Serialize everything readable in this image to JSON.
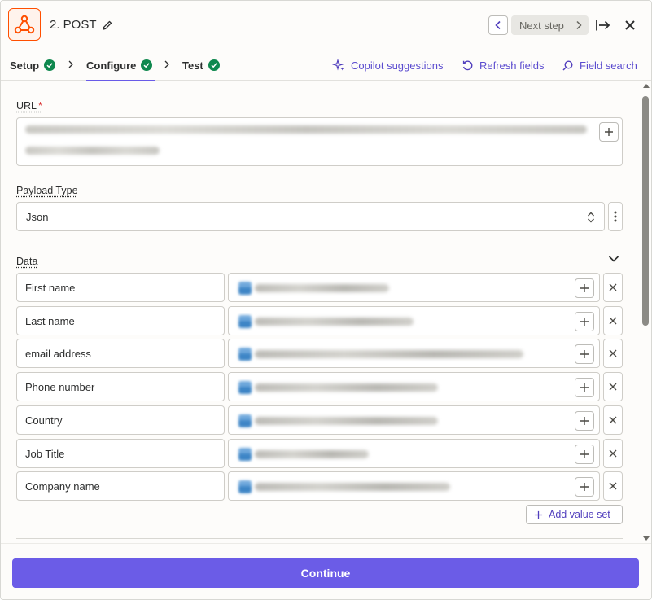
{
  "header": {
    "step_title": "2. POST",
    "next_step_label": "Next step",
    "app_icon": "webhook-icon"
  },
  "tabs": [
    {
      "label": "Setup",
      "status": "complete"
    },
    {
      "label": "Configure",
      "status": "complete",
      "active": true
    },
    {
      "label": "Test",
      "status": "complete"
    }
  ],
  "tools": {
    "copilot": "Copilot suggestions",
    "refresh": "Refresh fields",
    "search": "Field search"
  },
  "form": {
    "url_label": "URL",
    "url_required": "*",
    "payload_type_label": "Payload Type",
    "payload_type_value": "Json",
    "data_label": "Data",
    "rows": [
      {
        "key": "First name"
      },
      {
        "key": "Last name"
      },
      {
        "key": "email address"
      },
      {
        "key": "Phone number"
      },
      {
        "key": "Country"
      },
      {
        "key": "Job Title"
      },
      {
        "key": "Company name"
      }
    ],
    "add_value_set_label": "Add value set"
  },
  "footer": {
    "continue_label": "Continue"
  },
  "colors": {
    "accent": "#6b5ce7",
    "link": "#503ebd",
    "success": "#0f884e",
    "brand": "#ff4f00",
    "required": "#d92f2f"
  }
}
